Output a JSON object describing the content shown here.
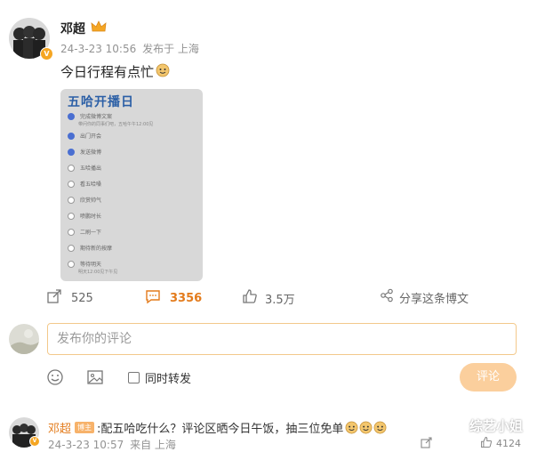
{
  "post": {
    "author": "邓超",
    "time": "24-3-23 10:56",
    "location": "发布于 上海",
    "text": "今日行程有点忙",
    "emoji_icon": "doge-emoji-icon",
    "crown_icon": "crown-badge-icon",
    "verified_icon": "verified-v-icon"
  },
  "image_card": {
    "title": "五哈开播日",
    "options": [
      {
        "label": "完成微博文案",
        "checked": true,
        "note": "带问你的同事们吧，五哈午午12:00见"
      },
      {
        "label": "出门开会",
        "checked": true
      },
      {
        "label": "发送微博",
        "checked": true
      },
      {
        "label": "五哈播出",
        "checked": false
      },
      {
        "label": "看五哈嗓",
        "checked": false
      },
      {
        "label": "欣赏帅气",
        "checked": false
      },
      {
        "label": "喷鹏时长",
        "checked": false
      },
      {
        "label": "二刷一下",
        "checked": false
      },
      {
        "label": "期待新的按摩",
        "checked": false
      },
      {
        "label": "等待明天",
        "checked": false,
        "note": "明天12:00见下午见"
      }
    ]
  },
  "actions": {
    "share_count": "525",
    "comment_count": "3356",
    "like_count": "3.5万",
    "share_post_label": "分享这条博文"
  },
  "comment_box": {
    "placeholder": "发布你的评论",
    "repost_label": "同时转发",
    "submit_label": "评论"
  },
  "top_comment": {
    "author": "邓超",
    "tag": "博主",
    "text": ":配五哈吃什么？评论区晒今日午饭，抽三位免单",
    "time": "24-3-23 10:57",
    "location": "来自 上海",
    "like_count": "4124"
  },
  "watermark": "综艺小姐",
  "colors": {
    "accent_orange": "#fbcf9d",
    "comment_count_orange": "#e37b1c",
    "card_blue": "#2b5fa6"
  }
}
